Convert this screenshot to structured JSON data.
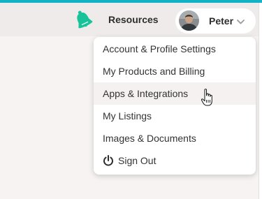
{
  "header": {
    "resources_label": "Resources",
    "user_name": "Peter"
  },
  "menu": {
    "items": [
      {
        "label": "Account & Profile Settings"
      },
      {
        "label": "My Products and Billing"
      },
      {
        "label": "Apps & Integrations",
        "hovered": true
      },
      {
        "label": "My Listings"
      },
      {
        "label": "Images & Documents"
      },
      {
        "label": "Sign Out",
        "icon": "power-icon"
      }
    ]
  },
  "colors": {
    "accent": "#12b3c4",
    "bell": "#19c39a",
    "header_bg": "#efebea",
    "page_bg": "#f6f3f2",
    "hover_bg": "#f4f1f0"
  }
}
